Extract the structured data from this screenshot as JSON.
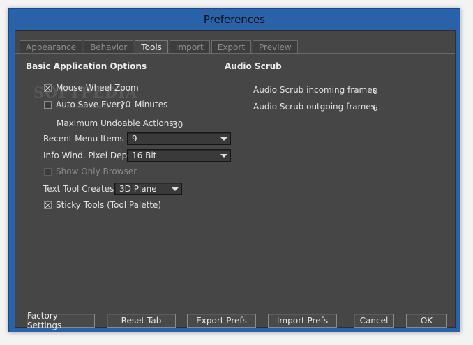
{
  "window": {
    "title": "Preferences"
  },
  "tabs": [
    {
      "label": "Appearance",
      "active": false
    },
    {
      "label": "Behavior",
      "active": false
    },
    {
      "label": "Tools",
      "active": true
    },
    {
      "label": "Import",
      "active": false
    },
    {
      "label": "Export",
      "active": false
    },
    {
      "label": "Preview",
      "active": false
    }
  ],
  "basic": {
    "heading": "Basic Application Options",
    "mouse_wheel_zoom": {
      "label": "Mouse Wheel Zoom",
      "checked": true
    },
    "auto_save": {
      "prefix": "Auto Save Every",
      "value": "10",
      "suffix": "Minutes",
      "checked": false
    },
    "max_undo": {
      "label": "Maximum Undoable Actions",
      "value": "30"
    },
    "recent_menu": {
      "label": "Recent Menu Items",
      "value": "9"
    },
    "pixel_depth": {
      "label": "Info Wind. Pixel Depth",
      "value": "16 Bit"
    },
    "show_only_browser": {
      "label": "Show Only Browser",
      "checked": false,
      "enabled": false
    },
    "text_tool": {
      "label": "Text Tool Creates",
      "value": "3D Plane"
    },
    "sticky_tools": {
      "label": "Sticky Tools (Tool Palette)",
      "checked": true
    }
  },
  "audio": {
    "heading": "Audio Scrub",
    "incoming": {
      "label": "Audio Scrub incoming frames",
      "value": "0"
    },
    "outgoing": {
      "label": "Audio Scrub outgoing frames",
      "value": "6"
    }
  },
  "watermark": {
    "text": "SOFTPEDIA",
    "sub": "www.softpedia.com"
  },
  "buttons": {
    "factory": "Factory Settings",
    "reset": "Reset Tab",
    "export": "Export Prefs",
    "import": "Import Prefs",
    "cancel": "Cancel",
    "ok": "OK"
  }
}
